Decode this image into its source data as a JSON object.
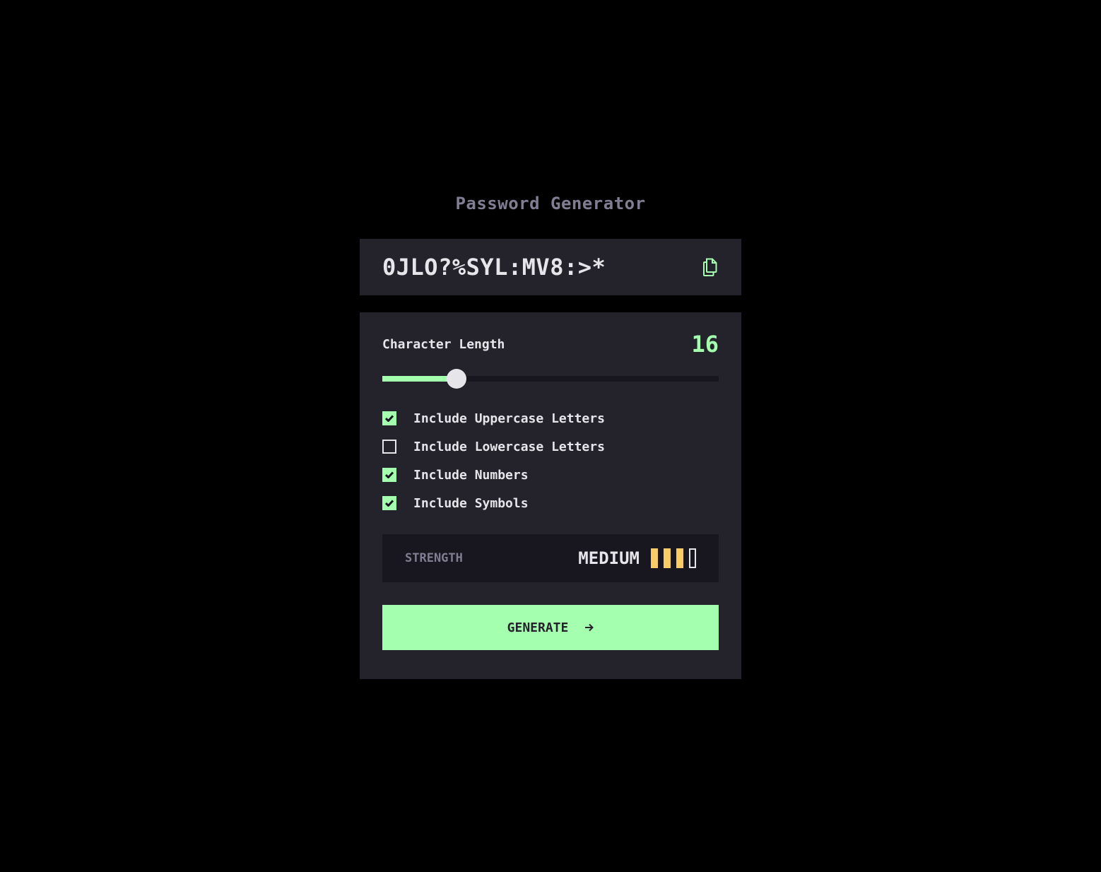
{
  "app": {
    "title": "Password Generator"
  },
  "password": {
    "value": "0JLO?%SYL:MV8:>*",
    "copy_icon": "copy-icon"
  },
  "length": {
    "label": "Character Length",
    "value": "16",
    "slider_fraction": 0.22
  },
  "options": [
    {
      "label": "Include Uppercase Letters",
      "checked": true
    },
    {
      "label": "Include Lowercase Letters",
      "checked": false
    },
    {
      "label": "Include Numbers",
      "checked": true
    },
    {
      "label": "Include Symbols",
      "checked": true
    }
  ],
  "strength": {
    "label": "STRENGTH",
    "value": "MEDIUM",
    "level": 3,
    "max_level": 4
  },
  "generate": {
    "label": "GENERATE",
    "icon": "arrow-right-icon"
  },
  "colors": {
    "accent": "#A4FFAF",
    "strength_medium": "#F8CD65",
    "panel": "#24232C",
    "background": "#000000",
    "text": "#E6E5EA",
    "muted": "#817D92",
    "dark": "#18171F"
  }
}
